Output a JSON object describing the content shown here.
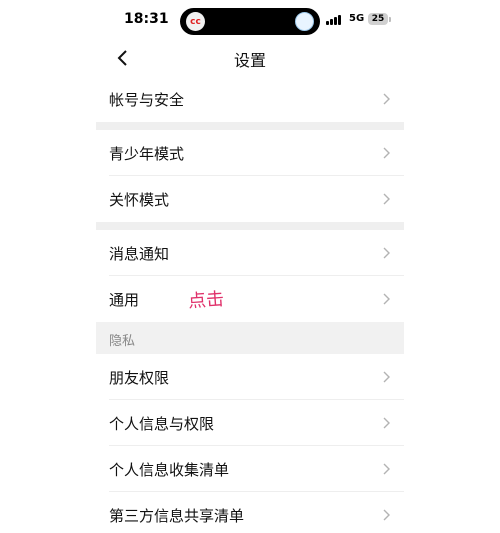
{
  "status_bar": {
    "time": "18:31",
    "network": "5G",
    "battery": "25",
    "island_app_icon": "cc-app-icon"
  },
  "header": {
    "title": "设置",
    "back_icon": "chevron-left-icon"
  },
  "groups": [
    {
      "items": [
        {
          "label": "帐号与安全"
        }
      ]
    },
    {
      "items": [
        {
          "label": "青少年模式"
        },
        {
          "label": "关怀模式"
        }
      ]
    },
    {
      "items": [
        {
          "label": "消息通知"
        },
        {
          "label": "通用"
        }
      ]
    }
  ],
  "privacy_section": {
    "header": "隐私",
    "items": [
      {
        "label": "朋友权限"
      },
      {
        "label": "个人信息与权限"
      },
      {
        "label": "个人信息收集清单"
      },
      {
        "label": "第三方信息共享清单"
      }
    ]
  },
  "annotation": {
    "text": "点击"
  },
  "colors": {
    "background": "#ffffff",
    "separator": "#efefef",
    "annotation": "#e0306a",
    "chevron": "#b3b3b3"
  }
}
